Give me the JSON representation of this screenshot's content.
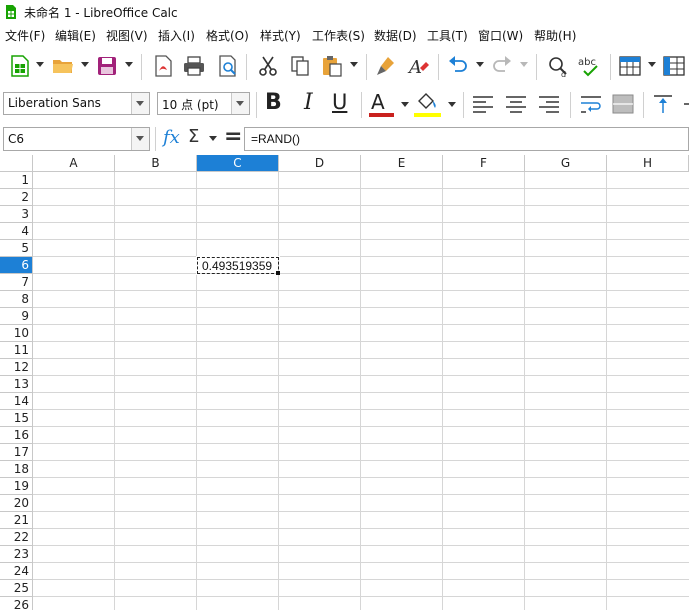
{
  "window": {
    "title": "未命名 1 - LibreOffice Calc"
  },
  "menu": [
    {
      "label": "文件(F)"
    },
    {
      "label": "编辑(E)"
    },
    {
      "label": "视图(V)"
    },
    {
      "label": "插入(I)"
    },
    {
      "label": "格式(O)"
    },
    {
      "label": "样式(Y)"
    },
    {
      "label": "工作表(S)"
    },
    {
      "label": "数据(D)"
    },
    {
      "label": "工具(T)"
    },
    {
      "label": "窗口(W)"
    },
    {
      "label": "帮助(H)"
    }
  ],
  "format_toolbar": {
    "font_name": "Liberation Sans",
    "font_size": "10 点 (pt)",
    "bold_label": "B",
    "italic_label": "I",
    "underline_label": "U",
    "font_color_label": "A"
  },
  "formula_bar": {
    "cell_ref": "C6",
    "fx_label": "fx",
    "sum_label": "Σ",
    "equals_label": "=",
    "formula": "=RAND()"
  },
  "sheet": {
    "columns": [
      "A",
      "B",
      "C",
      "D",
      "E",
      "F",
      "G",
      "H"
    ],
    "rows": [
      "1",
      "2",
      "3",
      "4",
      "5",
      "6",
      "7",
      "8",
      "9",
      "10",
      "11",
      "12",
      "13",
      "14",
      "15",
      "16",
      "17",
      "18",
      "19",
      "20",
      "21",
      "22",
      "23",
      "24",
      "25",
      "26"
    ],
    "active_column": "C",
    "active_row": "6",
    "active_cell_value": "0.493519359"
  },
  "colors": {
    "accent": "#1d80d6",
    "font_color_bar": "#c9211e",
    "highlight_bar": "#ffff00"
  }
}
